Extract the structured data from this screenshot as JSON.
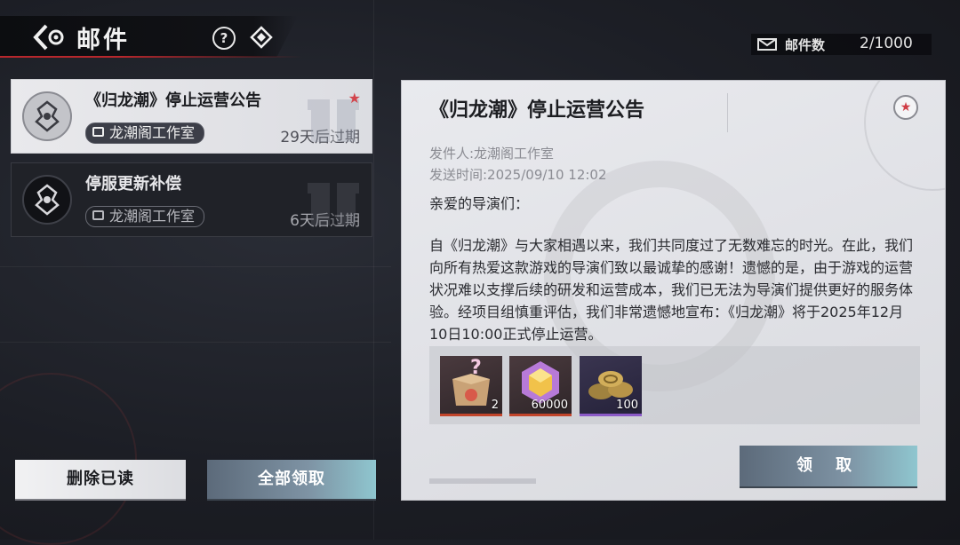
{
  "header": {
    "title": "邮件",
    "help_icon": "help-icon",
    "diamond_icon": "diamond-icon",
    "back_icon": "back-arrow-icon"
  },
  "mail_count": {
    "label": "邮件数",
    "value": "2/1000",
    "icon": "envelope-icon"
  },
  "mails": [
    {
      "title": "《归龙潮》停止运营公告",
      "sender": "龙潮阁工作室",
      "expire": "29天后过期",
      "selected": true,
      "starred": true
    },
    {
      "title": "停服更新补偿",
      "sender": "龙潮阁工作室",
      "expire": "6天后过期",
      "selected": false,
      "starred": false
    }
  ],
  "actions": {
    "delete_read": "删除已读",
    "claim_all": "全部领取"
  },
  "detail": {
    "title": "《归龙潮》停止运营公告",
    "sender_line": "发件人:龙潮阁工作室",
    "time_line": "发送时间:2025/09/10 12:02",
    "greeting": "亲爱的导演们：",
    "body": "自《归龙潮》与大家相遇以来，我们共同度过了无数难忘的时光。在此，我们向所有热爱这款游戏的导演们致以最诚挚的感谢！遗憾的是，由于游戏的运营状况难以支撑后续的研发和运营成本，我们已无法为导演们提供更好的服务体验。经项目组慎重评估，我们非常遗憾地宣布：《归龙潮》将于2025年12月10日10:00正式停止运营。",
    "rewards": [
      {
        "icon": "mystery-box-icon",
        "qty": "2"
      },
      {
        "icon": "crystal-icon",
        "qty": "60000"
      },
      {
        "icon": "coins-icon",
        "qty": "100"
      }
    ],
    "claim_label": "领 取"
  },
  "colors": {
    "accent_red": "#b8272c",
    "button_teal": "#8fc6cf",
    "panel_bg": "#e3e4e8"
  }
}
